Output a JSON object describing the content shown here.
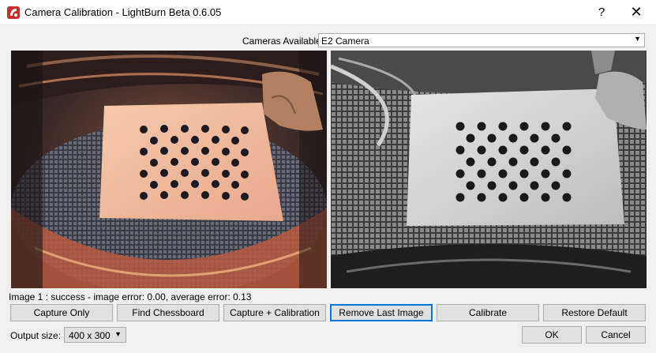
{
  "window": {
    "title": "Camera Calibration - LightBurn Beta 0.6.05",
    "help_glyph": "?",
    "close_glyph": "✕"
  },
  "cameras": {
    "label": "Cameras Available:",
    "selected": "E2 Camera"
  },
  "status_text": "Image 1 : success - image error: 0.00, average error: 0.13",
  "buttons": {
    "capture_only": "Capture Only",
    "find_chessboard": "Find Chessboard",
    "capture_calibration": "Capture + Calibration",
    "remove_last": "Remove Last Image",
    "calibrate": "Calibrate",
    "restore_default": "Restore Default",
    "ok": "OK",
    "cancel": "Cancel"
  },
  "output": {
    "label": "Output size:",
    "selected": "400 x 300"
  },
  "colors": {
    "accent_focus": "#0078d7",
    "logo_red": "#c8312b"
  }
}
